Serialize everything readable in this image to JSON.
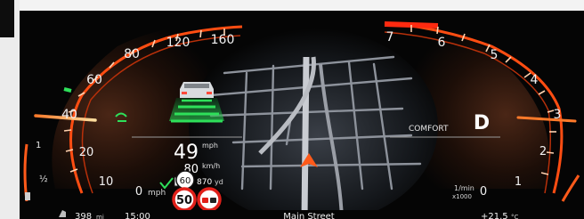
{
  "speedometer": {
    "ticks": [
      "160",
      "120",
      "80",
      "60",
      "40",
      "20",
      "10",
      "0"
    ],
    "unit": "mph",
    "needle_value_mph": 40
  },
  "tachometer": {
    "ticks": [
      "7",
      "6",
      "5",
      "4",
      "3",
      "2",
      "1",
      "0"
    ],
    "unit_line1": "1/min",
    "unit_line2": "x1000",
    "needle_value_rpm_x1000": 3
  },
  "gear": "D",
  "drive_mode": "COMFORT",
  "speed": {
    "main_value": "49",
    "main_unit": "mph",
    "secondary_value": "80",
    "secondary_unit": "km/h"
  },
  "speed_limit": {
    "set_value": "60",
    "distance_value": "870",
    "distance_unit": "yd",
    "sign_value": "50"
  },
  "navigation": {
    "street_name": "Main Street"
  },
  "status_bar": {
    "range_value": "398",
    "range_unit": "mi",
    "time": "15:00",
    "temperature": "+21.5",
    "temperature_unit": "°C"
  },
  "fuel": {
    "marks": [
      "1",
      "½"
    ]
  },
  "colors": {
    "accent_orange": "#ff5a1a",
    "assist_green": "#2ee05a",
    "background": "#050505",
    "sign_red": "#e0201a"
  }
}
